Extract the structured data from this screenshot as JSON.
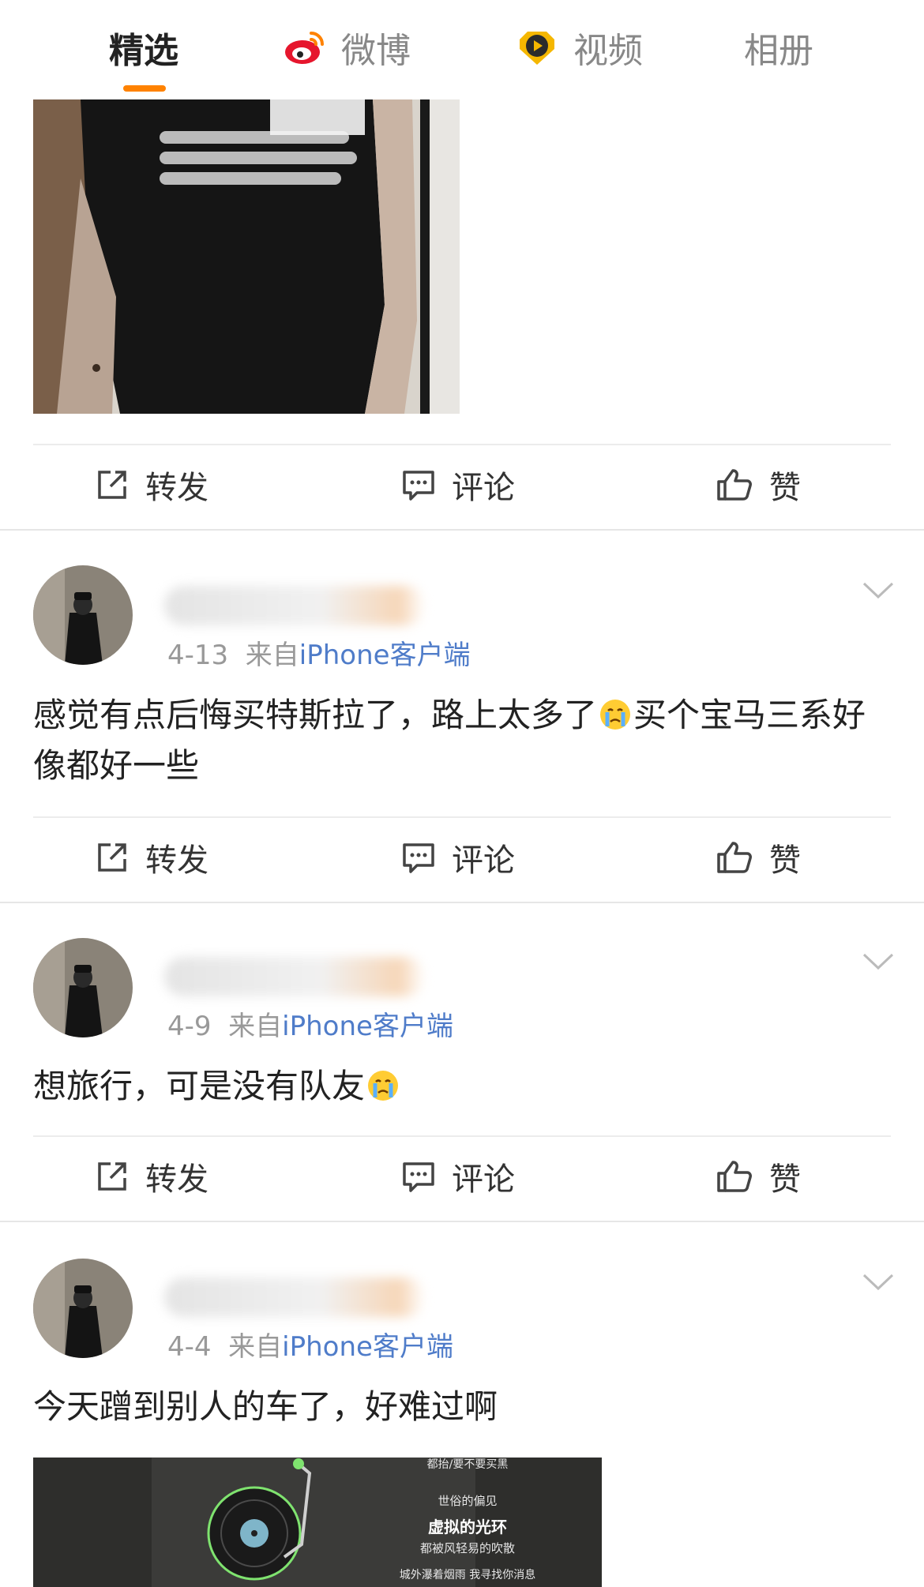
{
  "tabs": [
    {
      "label": "精选",
      "active": true
    },
    {
      "label": "微博",
      "icon": "weibo-logo-icon"
    },
    {
      "label": "视频",
      "icon": "video-play-icon"
    },
    {
      "label": "相册"
    }
  ],
  "colors": {
    "accent": "#ff8200",
    "source_link": "#4f7cc9",
    "muted": "#999999"
  },
  "actions": {
    "repost": "转发",
    "comment": "评论",
    "like": "赞"
  },
  "posts": [
    {
      "date": "4-13",
      "from": "来自",
      "source": "iPhone客户端",
      "text_a": "感觉有点后悔买特斯拉了，路上太多了",
      "emoji": "crying-face-icon",
      "text_b": "买个宝马三系好像都好一些"
    },
    {
      "date": "4-9",
      "from": "来自",
      "source": "iPhone客户端",
      "text_a": "想旅行，可是没有队友",
      "emoji": "crying-face-icon"
    },
    {
      "date": "4-4",
      "from": "来自",
      "source": "iPhone客户端",
      "text_a": "今天蹭到别人的车了，好难过啊"
    }
  ],
  "lyrics_image": {
    "lines": [
      "都抬/要不要买黑",
      "世俗的偏见",
      "虚拟的光环",
      "都被风轻易的吹散",
      "城外瀑着烟雨 我寻找你消息"
    ]
  }
}
